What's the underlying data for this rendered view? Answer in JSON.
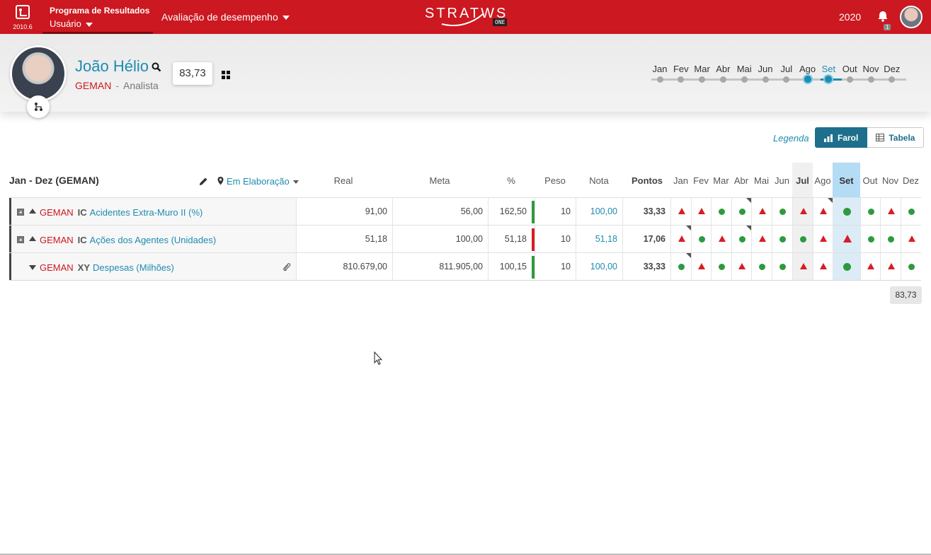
{
  "topbar": {
    "version": "2010.6",
    "program_title": "Programa de Resultados",
    "user_menu": "Usuário",
    "evaluation_menu": "Avaliação de desempenho",
    "logo_text": "STRATWS",
    "logo_badge": "ONE",
    "year": "2020",
    "notifications_count": "1"
  },
  "profile": {
    "name": "João Hélio",
    "unit": "GEMAN",
    "separator": "-",
    "role": "Analista",
    "score": "83,73"
  },
  "months": [
    "Jan",
    "Fev",
    "Mar",
    "Abr",
    "Mai",
    "Jun",
    "Jul",
    "Ago",
    "Set",
    "Out",
    "Nov",
    "Dez"
  ],
  "months_active_range": [
    "Ago",
    "Set"
  ],
  "toolbar": {
    "legend": "Legenda",
    "farol_label": "Farol",
    "tabela_label": "Tabela"
  },
  "table": {
    "period": "Jan - Dez (GEMAN)",
    "status": "Em Elaboração",
    "columns": {
      "real": "Real",
      "meta": "Meta",
      "pct": "%",
      "peso": "Peso",
      "nota": "Nota",
      "pontos": "Pontos"
    },
    "month_headers": [
      "Jan",
      "Fev",
      "Mar",
      "Abr",
      "Mai",
      "Jun",
      "Jul",
      "Ago",
      "Set",
      "Out",
      "Nov",
      "Dez"
    ],
    "rows": [
      {
        "org": "GEMAN",
        "code": "IC",
        "indicator": "Acidentes Extra-Muro II (%)",
        "real": "91,00",
        "meta": "56,00",
        "pct": "162,50",
        "bar_color": "#2e9a3e",
        "peso": "10",
        "nota": "100,00",
        "pontos": "33,33",
        "signals": [
          "red",
          "red",
          "green",
          "green",
          "red",
          "green",
          "red",
          "red",
          "green",
          "green",
          "red",
          "green"
        ],
        "corners": [
          false,
          false,
          false,
          true,
          false,
          false,
          false,
          true,
          false,
          false,
          false,
          false
        ]
      },
      {
        "org": "GEMAN",
        "code": "IC",
        "indicator": "Ações dos Agentes (Unidades)",
        "real": "51,18",
        "meta": "100,00",
        "pct": "51,18",
        "bar_color": "#d81c24",
        "peso": "10",
        "nota": "51,18",
        "pontos": "17,06",
        "signals": [
          "red",
          "green",
          "red",
          "green",
          "red",
          "green",
          "green",
          "red",
          "red",
          "green",
          "green",
          "red"
        ],
        "corners": [
          true,
          false,
          false,
          true,
          false,
          false,
          false,
          false,
          false,
          false,
          false,
          false
        ]
      },
      {
        "org": "GEMAN",
        "code": "XY",
        "indicator": "Despesas (Milhões)",
        "real": "810.679,00",
        "meta": "811.905,00",
        "pct": "100,15",
        "bar_color": "#2e9a3e",
        "peso": "10",
        "nota": "100,00",
        "pontos": "33,33",
        "signals": [
          "green",
          "red",
          "green",
          "red",
          "green",
          "green",
          "red",
          "red",
          "green",
          "red",
          "red",
          "green"
        ],
        "corners": [
          true,
          false,
          false,
          false,
          false,
          false,
          false,
          false,
          false,
          false,
          false,
          false
        ]
      }
    ],
    "total": "83,73"
  }
}
